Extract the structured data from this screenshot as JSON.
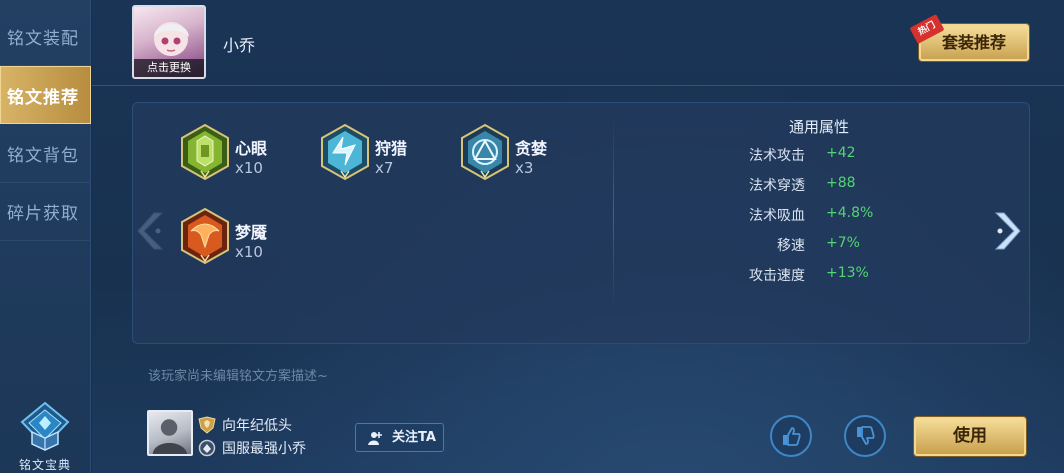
{
  "sidebar": {
    "items": [
      {
        "label": "铭文装配",
        "active": false
      },
      {
        "label": "铭文推荐",
        "active": true
      },
      {
        "label": "铭文背包",
        "active": false
      },
      {
        "label": "碎片获取",
        "active": false
      }
    ],
    "bottom_label": "铭文宝典"
  },
  "header": {
    "avatar_caption": "点击更换",
    "hero_name": "小乔",
    "recommend_button": "套装推荐",
    "hot_tag": "热门"
  },
  "runes": [
    {
      "name": "心眼",
      "count": "x10",
      "color": "#7fae2e"
    },
    {
      "name": "狩猎",
      "count": "x7",
      "color": "#3fa7c9"
    },
    {
      "name": "贪婪",
      "count": "x3",
      "color": "#3d7fa3"
    },
    {
      "name": "梦魇",
      "count": "x10",
      "color": "#d2521e"
    }
  ],
  "stats": {
    "title": "通用属性",
    "rows": [
      {
        "label": "法术攻击",
        "value": "+42"
      },
      {
        "label": "法术穿透",
        "value": "+88"
      },
      {
        "label": "法术吸血",
        "value": "+4.8%"
      },
      {
        "label": "移速",
        "value": "+7%"
      },
      {
        "label": "攻击速度",
        "value": "+13%"
      }
    ]
  },
  "description": "该玩家尚未编辑铭文方案描述~",
  "player": {
    "name": "向年纪低头",
    "title": "国服最强小乔",
    "follow_label": "关注TA"
  },
  "actions": {
    "use_label": "使用"
  },
  "colors": {
    "accent_gold": "#d8b467",
    "stat_green": "#51d671",
    "background": "#17304f"
  }
}
